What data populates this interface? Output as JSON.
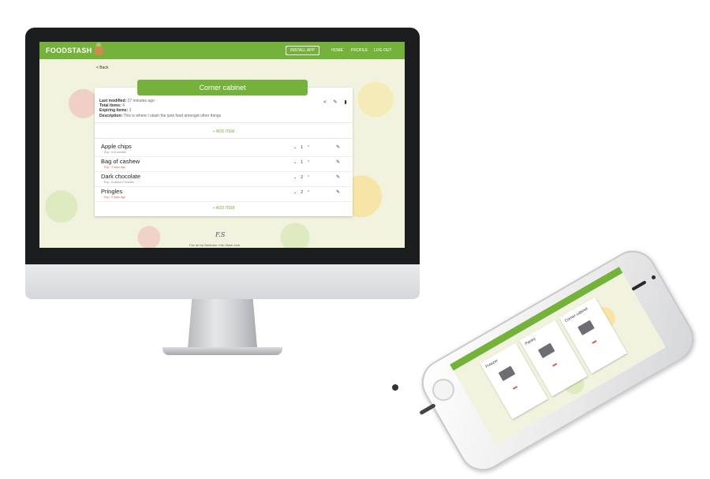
{
  "app": {
    "brand": "FOODSTASH",
    "nav": {
      "install": "INSTALL APP",
      "home": "HOME",
      "profile": "PROFILE",
      "logout": "LOG OUT"
    },
    "back": "< Back",
    "stash": {
      "title": "Corner cabinet",
      "last_modified_label": "Last modified:",
      "last_modified_value": "27 minutes ago",
      "total_items_label": "Total items:",
      "total_items_value": "4",
      "expiring_label": "Expiring items:",
      "expiring_value": "3",
      "description_label": "Description:",
      "description_value": "This is where I stash the junk food amongst other things",
      "add_item": "+ ADD ITEM"
    },
    "items": [
      {
        "name": "Apple chips",
        "expiry": "Exp.: in 8 months",
        "qty": "1",
        "expiring": false
      },
      {
        "name": "Bag of cashew",
        "expiry": "Exp.: 3 days ago",
        "qty": "1",
        "expiring": true
      },
      {
        "name": "Dark chocolate",
        "expiry": "Exp.: in about 2 months",
        "qty": "2",
        "expiring": false
      },
      {
        "name": "Pringles",
        "expiry": "Exp.: 6 days ago",
        "qty": "2",
        "expiring": true
      }
    ],
    "footer_text": "Fan art by illustrator. Info-Stash.com"
  },
  "phone": {
    "cards": [
      {
        "title": "Corner cabinet"
      },
      {
        "title": "Pantry"
      },
      {
        "title": "Freezer"
      }
    ]
  },
  "colors": {
    "accent": "#74b23c",
    "expiring": "#e05a4e"
  }
}
